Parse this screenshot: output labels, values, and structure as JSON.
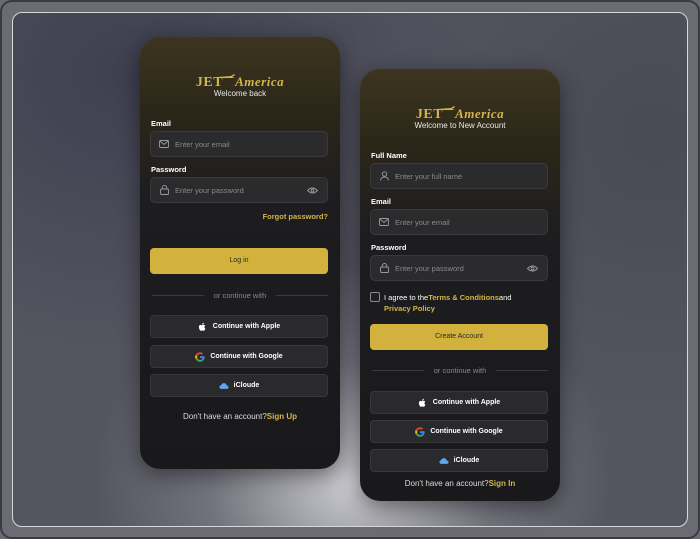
{
  "colors": {
    "accent": "#d2b23c",
    "card_bg": "#1d1d1f",
    "field_bg": "#2b2b2e"
  },
  "brand": {
    "jet": "JET",
    "america": "America"
  },
  "login": {
    "welcome": "Welcome back",
    "email_label": "Email",
    "email_placeholder": "Enter your email",
    "password_label": "Password",
    "password_placeholder": "Enter your password",
    "forgot": "Forgot password?",
    "login_button": "Log in",
    "divider": "or continue with",
    "apple": "Continue with Apple",
    "google": "Continue with Google",
    "icloud": "iCloude",
    "footer_text": "Don't have an account?",
    "footer_link": "Sign Up"
  },
  "signup": {
    "welcome": "Welcome to New Account",
    "name_label": "Full Name",
    "name_placeholder": "Enter your full name",
    "email_label": "Email",
    "email_placeholder": "Enter your email",
    "password_label": "Password",
    "password_placeholder": "Enter your password",
    "agree_prefix": "I agree to the",
    "terms": "Terms & Conditions",
    "agree_and": "and",
    "privacy": "Privacy Policy",
    "create_button": "Create Account",
    "divider": "or continue with",
    "apple": "Continue with Apple",
    "google": "Continue with Google",
    "icloud": "iCloude",
    "footer_text": "Don't have an account?",
    "footer_link": "Sign In"
  }
}
